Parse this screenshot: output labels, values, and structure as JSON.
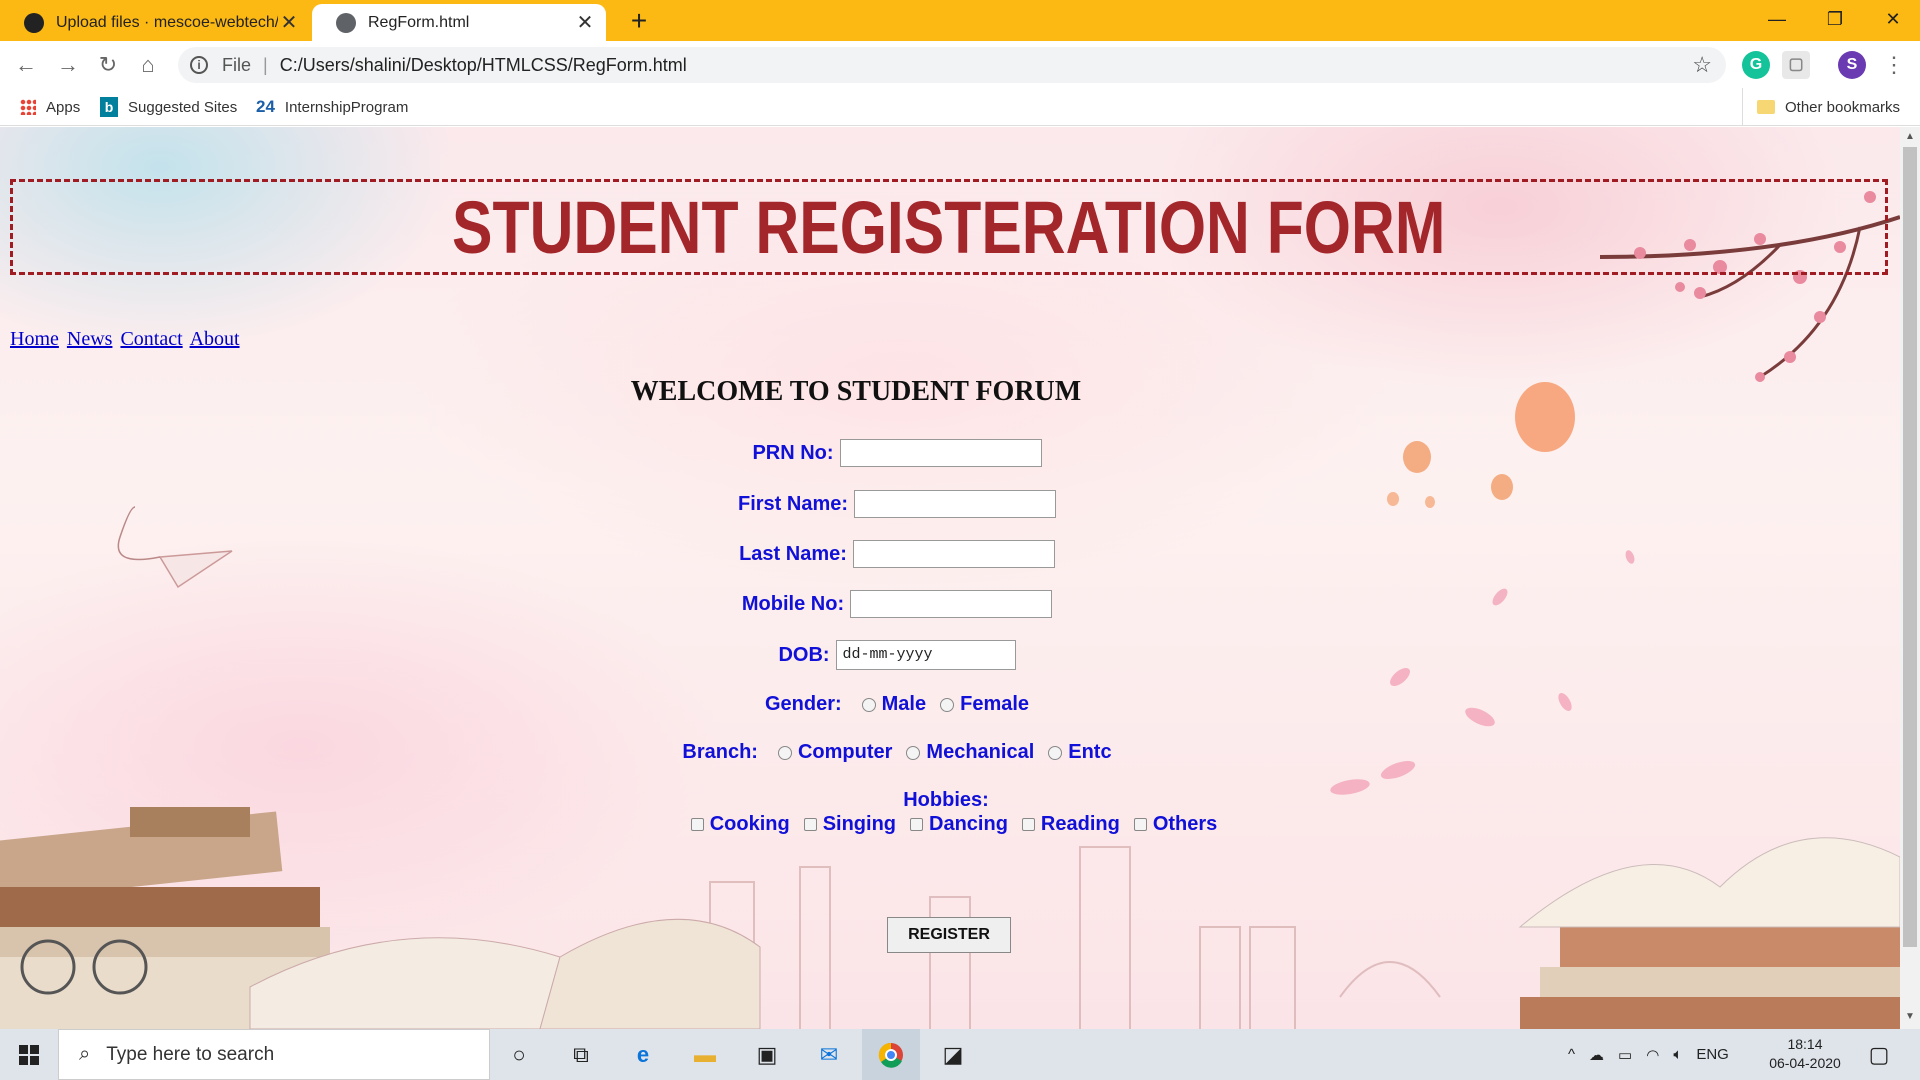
{
  "browser": {
    "tabs": [
      {
        "title": "Upload files · mescoe-webtech/a",
        "active": false
      },
      {
        "title": "RegForm.html",
        "active": true
      }
    ],
    "address": {
      "scheme_label": "File",
      "url": "C:/Users/shalini/Desktop/HTMLCSS/RegForm.html"
    },
    "profile_initial": "S",
    "bookmarks": [
      "Apps",
      "Suggested Sites",
      "InternshipProgram"
    ],
    "bookmark_prefix_24": "24",
    "other_bookmarks": "Other bookmarks"
  },
  "page": {
    "title": "STUDENT REGISTERATION FORM",
    "nav": [
      "Home",
      "News",
      "Contact",
      "About"
    ],
    "welcome": "WELCOME TO STUDENT FORUM",
    "form": {
      "prn_label": "PRN No:",
      "first_label": "First Name:",
      "last_label": "Last Name:",
      "mobile_label": "Mobile No:",
      "dob_label": "DOB:",
      "dob_placeholder": "dd-mm-yyyy",
      "gender_label": "Gender:",
      "gender_options": [
        "Male",
        "Female"
      ],
      "branch_label": "Branch:",
      "branch_options": [
        "Computer",
        "Mechanical",
        "Entc"
      ],
      "hobbies_label": "Hobbies:",
      "hobby_options": [
        "Cooking",
        "Singing",
        "Dancing",
        "Reading",
        "Others"
      ],
      "submit_label": "REGISTER"
    }
  },
  "taskbar": {
    "search_placeholder": "Type here to search",
    "language": "ENG",
    "time": "18:14",
    "date": "06-04-2020"
  },
  "colors": {
    "tabbar": "#FDB913",
    "title_red": "#a3262a",
    "label_blue": "#1010d8",
    "link_blue": "#0000cc"
  }
}
